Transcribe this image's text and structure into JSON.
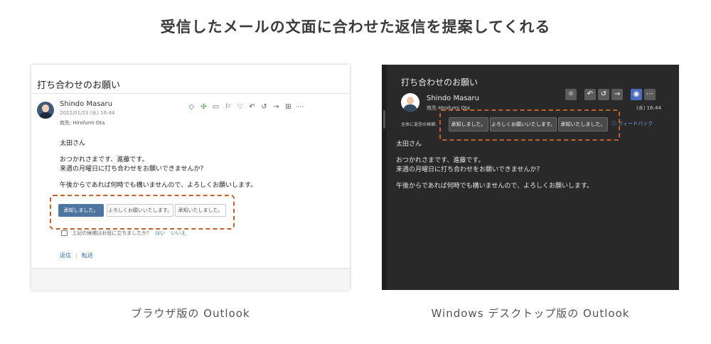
{
  "headline": "受信したメールの文面に合わせた返信を提案してくれる",
  "captions": {
    "left": "ブラウザ版の Outlook",
    "right": "Windows デスクトップ版の Outlook"
  },
  "web": {
    "subject": "打ち合わせのお願い",
    "sender": "Shindo Masaru",
    "date": "2022/01/23 (水) 16:44",
    "to": "宛先: Hirofumi Ota",
    "toolbar_icons": [
      "translate-icon",
      "apps-icon",
      "tag-icon",
      "flag-icon",
      "like-icon",
      "reply-icon",
      "reply-all-icon",
      "forward-icon",
      "grid-icon",
      "more-icon"
    ],
    "body": {
      "greeting": "太田さん",
      "line1": "おつかれさまです、進藤です。",
      "line2": "来週の月曜日に打ち合わせをお願いできませんか？",
      "line3": "午後からであれば何時でも構いませんので、よろしくお願いします。"
    },
    "suggested_replies": [
      "承知しました。",
      "よろしくお願いいたします。",
      "承知いたしました。"
    ],
    "feedback": {
      "question": "上記の候補はお役に立ちましたか?",
      "yes": "はい",
      "no": "いいえ"
    },
    "actions": {
      "reply": "返信",
      "forward": "転送"
    }
  },
  "desktop": {
    "subject": "打ち合わせのお願い",
    "sender": "Shindo Masaru",
    "to": "宛先  Hirofumi Ota",
    "date": "(水) 16:44",
    "toolbar_icons": [
      "sparkle-icon",
      "reply-icon",
      "reply-all-icon",
      "forward-icon",
      "teams-icon",
      "more-icon"
    ],
    "replies_label": "全体に返信の候補:",
    "suggested_replies": [
      "承知しました。",
      "よろしくお願いいたします。",
      "承知いたしました。"
    ],
    "feedback_link": "フィードバック",
    "body": {
      "greeting": "太田さん",
      "line1": "おつかれさまです、進藤です。",
      "line2": "来週の月曜日に打ち合わせをお願いできませんか？",
      "line3": "午後からであれば何時でも構いませんので、よろしくお願いします。"
    }
  },
  "colors": {
    "highlight_dash": "#c2622a",
    "web_primary": "#4e74a0",
    "desktop_bg": "#292929"
  }
}
